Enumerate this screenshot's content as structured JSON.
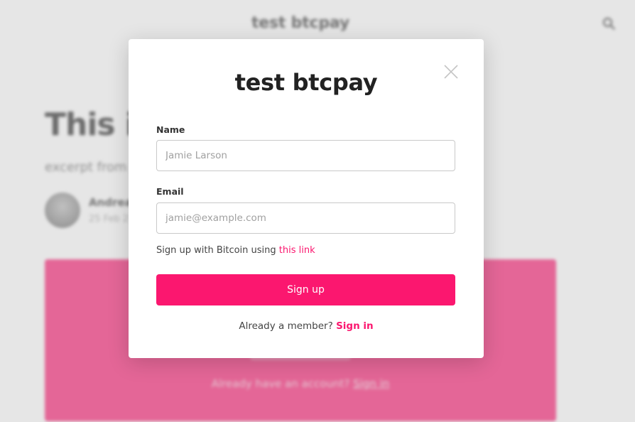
{
  "background_page": {
    "site_title": "test btcpay",
    "post_title": "This is",
    "excerpt": "excerpt from p",
    "author_name": "Andrea",
    "post_date": "25 Feb 2",
    "cta_text": "Already have an account?",
    "cta_link": "Sign in"
  },
  "modal": {
    "title": "test btcpay",
    "close_icon": "close-icon",
    "name_label": "Name",
    "name_placeholder": "Jamie Larson",
    "name_value": "",
    "email_label": "Email",
    "email_placeholder": "jamie@example.com",
    "email_value": "",
    "bitcoin_text": "Sign up with Bitcoin using",
    "bitcoin_link": "this link",
    "signup_button": "Sign up",
    "member_text": "Already a member?",
    "signin_link": "Sign in"
  },
  "colors": {
    "accent": "#fb176f",
    "overlay": "#c8c8c8",
    "text_dark": "#222222"
  }
}
